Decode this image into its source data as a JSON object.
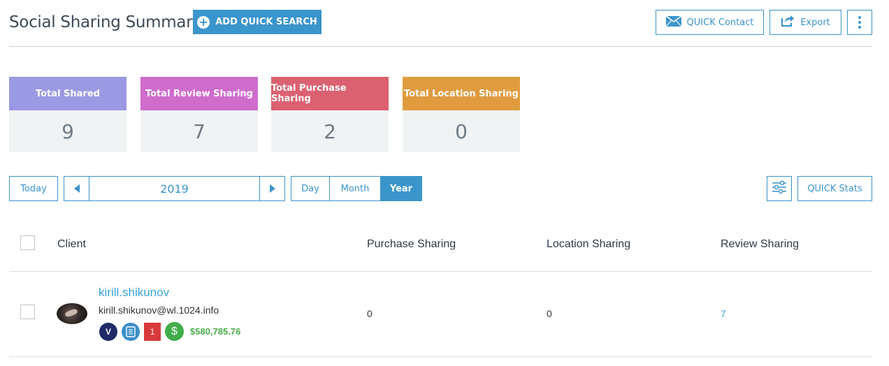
{
  "header": {
    "title": "Social Sharing Summary",
    "add_search_label": "ADD QUICK SEARCH",
    "contact_label": "QUICK Contact",
    "export_label": "Export"
  },
  "summary_cards": [
    {
      "label": "Total Shared",
      "value": "9",
      "color": "#9a99e3"
    },
    {
      "label": "Total Review Sharing",
      "value": "7",
      "color": "#cf6ccc"
    },
    {
      "label": "Total Purchase Sharing",
      "value": "2",
      "color": "#dc6170"
    },
    {
      "label": "Total Location Sharing",
      "value": "0",
      "color": "#e09b3f"
    }
  ],
  "controls": {
    "today_label": "Today",
    "period_value": "2019",
    "view_options": [
      "Day",
      "Month",
      "Year"
    ],
    "selected_view": "Year",
    "stats_label": "QUICK Stats"
  },
  "table": {
    "columns": [
      "Client",
      "Purchase Sharing",
      "Location Sharing",
      "Review Sharing"
    ],
    "rows": [
      {
        "name": "kirill.shikunov",
        "email": "kirill.shikunov@wl.1024.info",
        "badge_v": "V",
        "badge_count": "1",
        "amount": "$580,785.76",
        "purchase": "0",
        "location": "0",
        "review": "7"
      }
    ]
  },
  "colors": {
    "accent": "#3a95cc",
    "link": "#3aa2d6",
    "money": "#4cae4c"
  },
  "icons": {
    "add": "plus-circle-icon",
    "contact": "envelope-icon",
    "export": "share-arrow-icon",
    "more": "vertical-dots-icon",
    "filter": "sliders-icon",
    "prev": "triangle-left-icon",
    "next": "triangle-right-icon"
  }
}
